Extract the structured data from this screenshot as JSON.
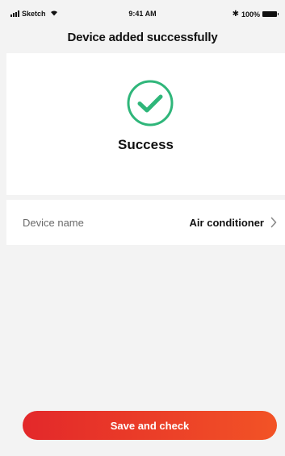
{
  "status_bar": {
    "carrier": "Sketch",
    "time": "9:41 AM",
    "battery": "100%",
    "icons": [
      "signal-icon",
      "wifi-icon",
      "bluetooth-icon",
      "battery-icon"
    ]
  },
  "header": {
    "title": "Device added successfully"
  },
  "result": {
    "icon": "check-circle-icon",
    "text": "Success",
    "accent": "#2fb67a"
  },
  "device": {
    "label": "Device name",
    "value": "Air conditioner",
    "icon": "chevron-right-icon"
  },
  "actions": {
    "save_label": "Save and check",
    "gradient": [
      "#e3282a",
      "#f25326"
    ]
  }
}
